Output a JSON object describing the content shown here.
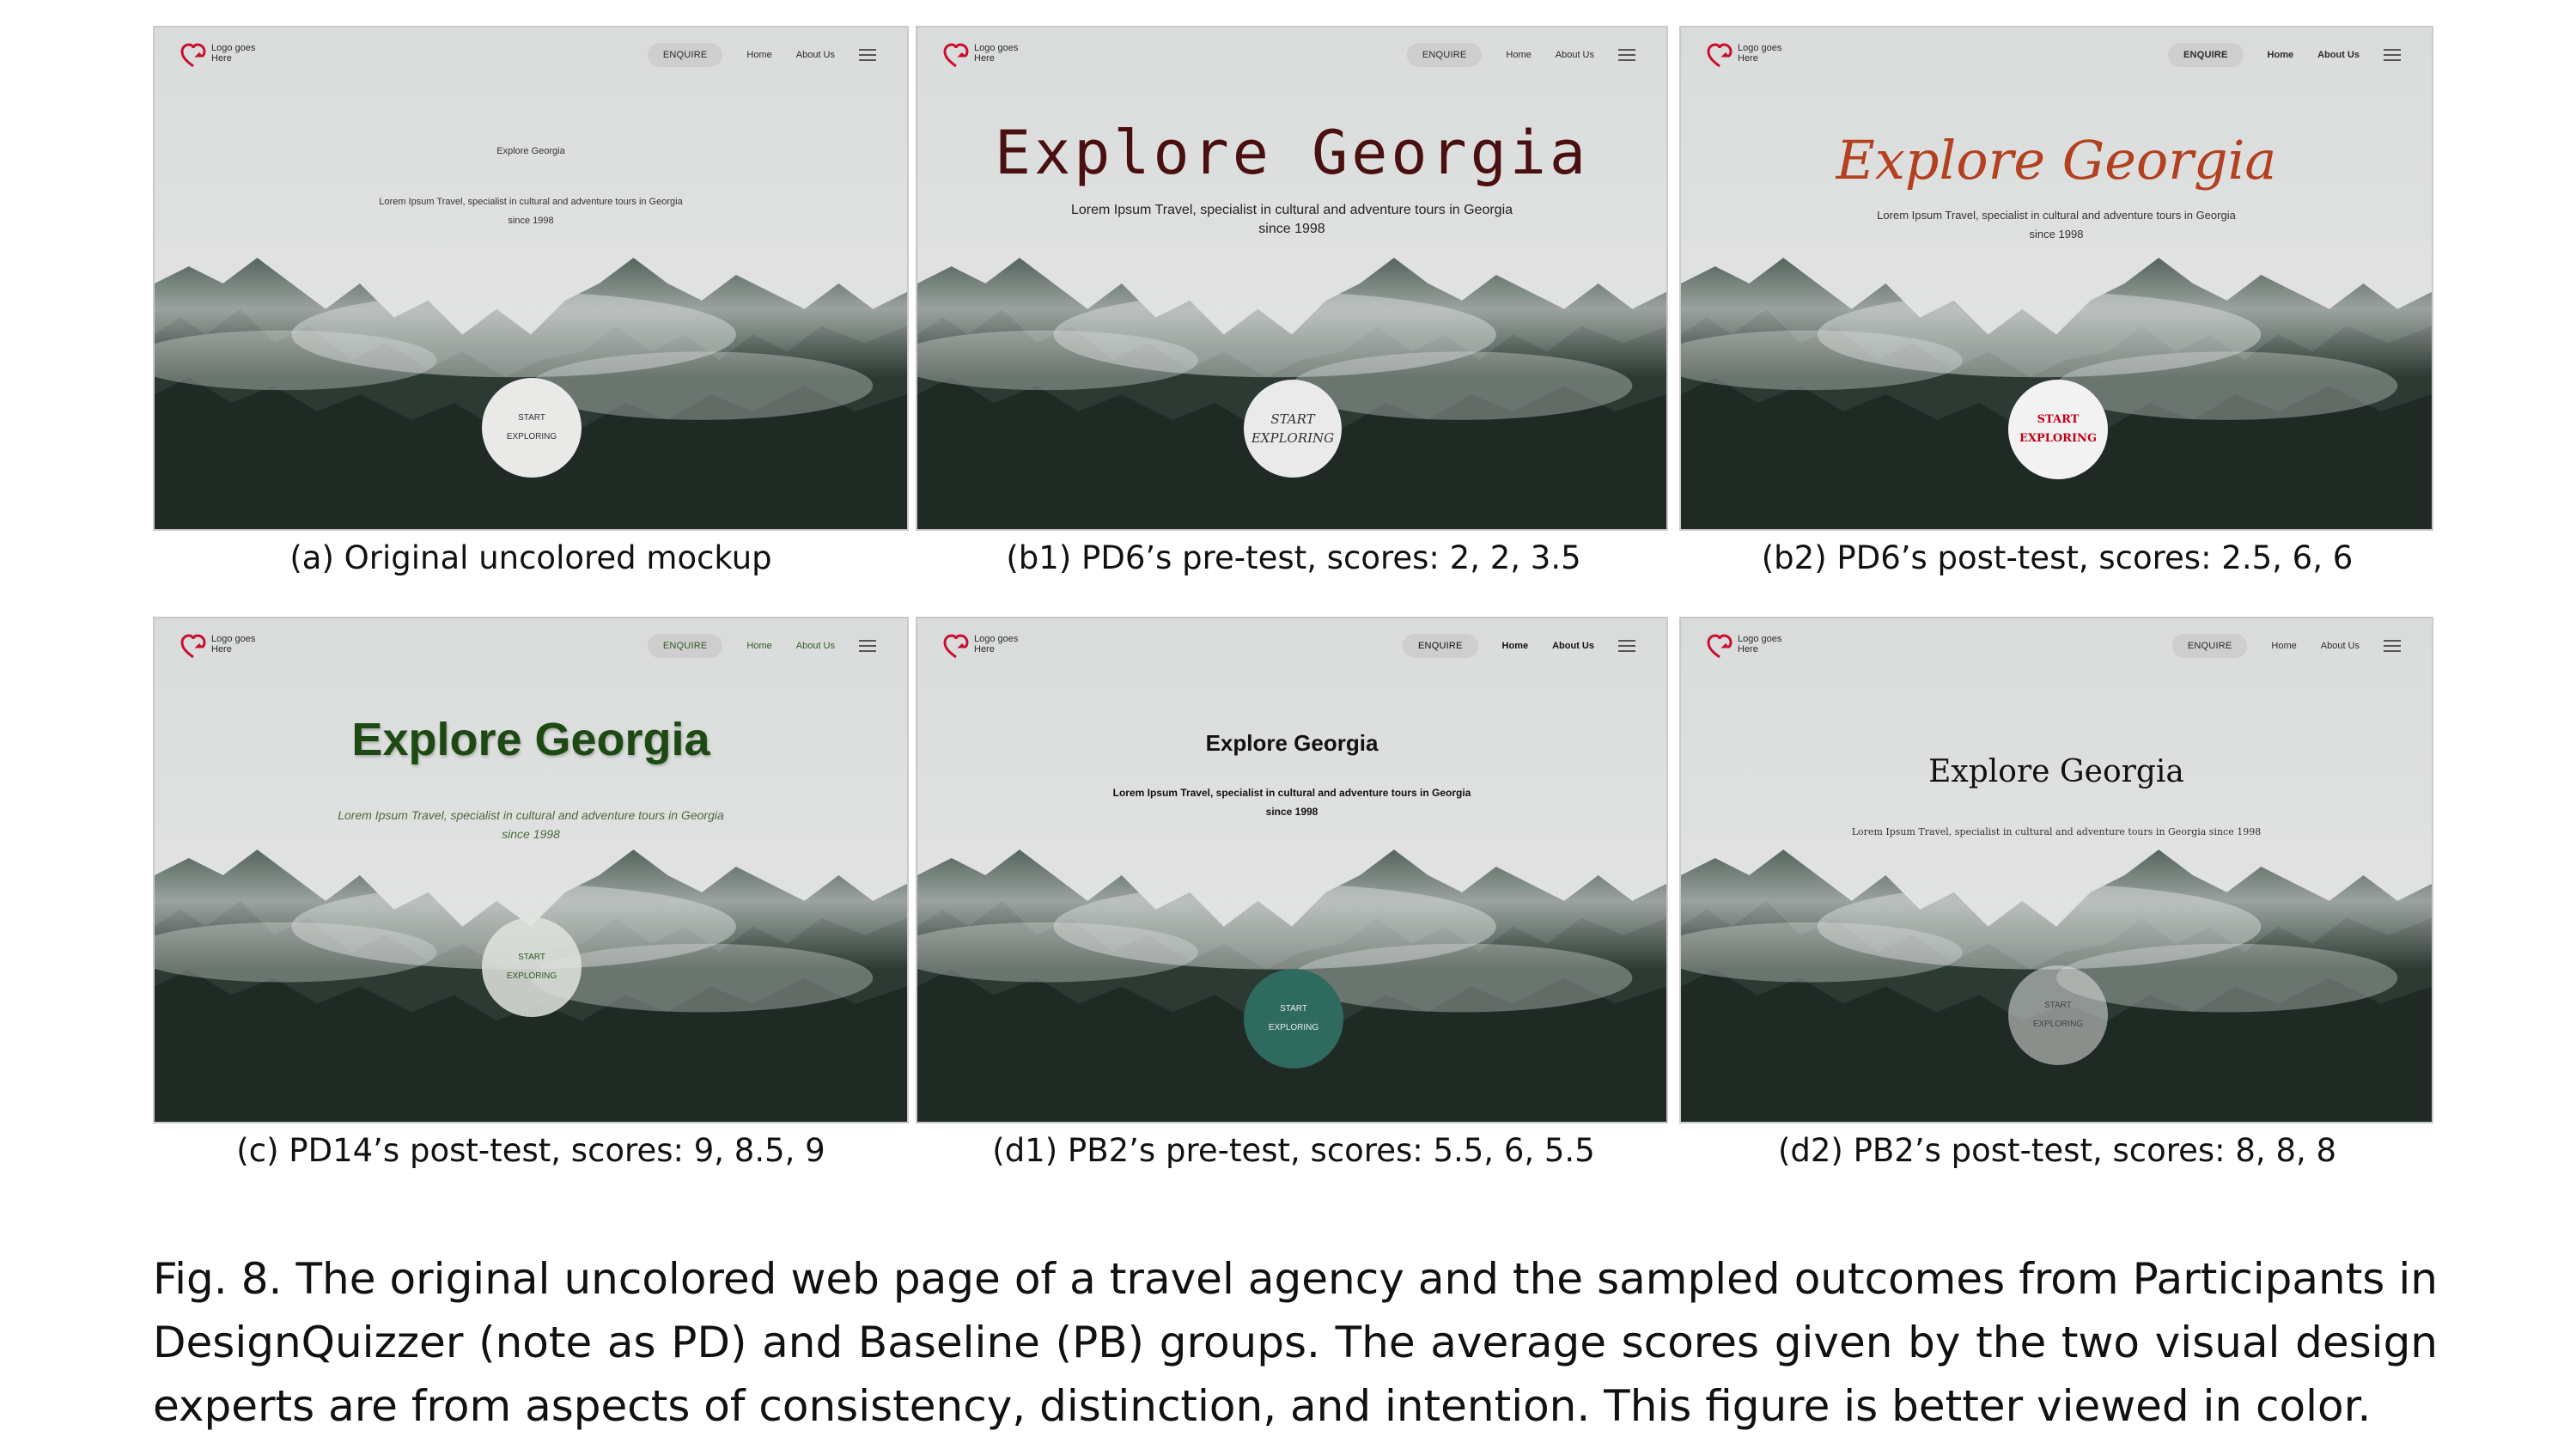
{
  "mockup_nav": {
    "logo_text": "Logo goes Here",
    "enquire": "ENQUIRE",
    "home": "Home",
    "about": "About Us"
  },
  "mockup_content": {
    "title": "Explore Georgia",
    "subtitle_line1": "Lorem Ipsum Travel, specialist in cultural and adventure tours in Georgia",
    "subtitle_line2": "since 1998",
    "subtitle_single": "Lorem Ipsum Travel, specialist in cultural and adventure tours in Georgia since 1998",
    "cta_line1": "START",
    "cta_line2": "EXPLORING"
  },
  "colors": {
    "logo_red": "#c8102e",
    "b1_title": "#4a1010",
    "b2_title": "#b3401f",
    "b2_cta_bg": "#f2f2f2",
    "b2_cta_text": "#c0001a",
    "c_title": "#1d4a12",
    "c_subtitle": "#4a6a3a",
    "d1_cta_bg": "#2e6a5e"
  },
  "captions": {
    "a": "(a) Original uncolored mockup",
    "b1": "(b1) PD6’s pre-test, scores: 2, 2, 3.5",
    "b2": "(b2) PD6’s post-test, scores: 2.5, 6, 6",
    "c": "(c) PD14’s post-test, scores: 9, 8.5, 9",
    "d1": "(d1) PB2’s pre-test, scores: 5.5, 6, 5.5",
    "d2": "(d2) PB2’s post-test, scores: 8, 8, 8"
  },
  "figure_caption": "Fig. 8.  The original uncolored web page of a travel agency and the sampled outcomes from Participants in DesignQuizzer (note as PD) and Baseline (PB) groups. The average scores given by the two visual design experts are from aspects of consistency, distinction, and intention. This figure is better viewed in color."
}
